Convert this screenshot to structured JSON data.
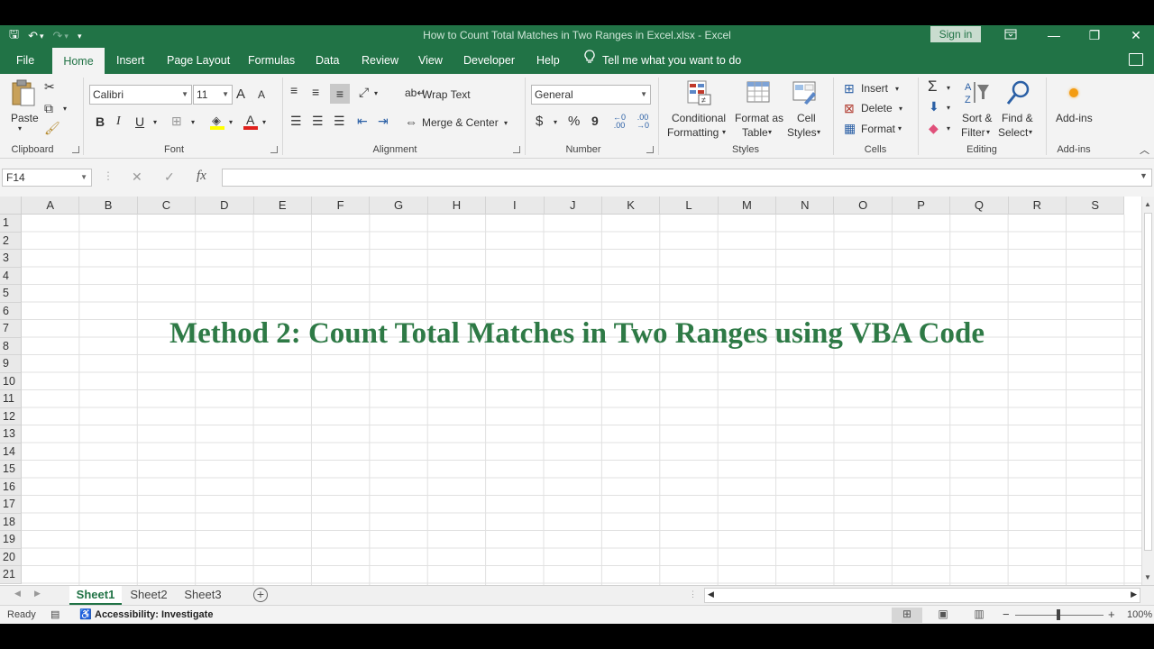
{
  "window": {
    "title": "How to Count Total Matches in Two Ranges in Excel.xlsx  -  Excel",
    "signin_label": "Sign in",
    "minimize": "—",
    "restore": "❐",
    "close": "✕"
  },
  "qat": {
    "save": "🖫",
    "undo": "↶",
    "undo_menu": "▾",
    "redo": "↷",
    "customize": "▾"
  },
  "tabs": [
    "File",
    "Home",
    "Insert",
    "Page Layout",
    "Formulas",
    "Data",
    "Review",
    "View",
    "Developer",
    "Help"
  ],
  "active_tab": "Home",
  "tell_me": "Tell me what you want to do",
  "ribbon": {
    "clipboard": {
      "paste": "Paste",
      "label": "Clipboard"
    },
    "font": {
      "name": "Calibri",
      "size": "11",
      "grow": "A",
      "shrink": "A",
      "bold": "B",
      "italic": "I",
      "underline": "U",
      "label": "Font"
    },
    "alignment": {
      "wrap_text": "Wrap Text",
      "merge_center": "Merge & Center",
      "label": "Alignment"
    },
    "number": {
      "format": "General",
      "currency": "$",
      "percent": "%",
      "comma": "9",
      "label": "Number"
    },
    "styles": {
      "conditional": [
        "Conditional",
        "Formatting"
      ],
      "format_as_table": [
        "Format as",
        "Table"
      ],
      "cell_styles": [
        "Cell",
        "Styles"
      ],
      "label": "Styles"
    },
    "cells": {
      "insert": "Insert",
      "delete": "Delete",
      "format": "Format",
      "label": "Cells"
    },
    "editing": {
      "sort_filter": [
        "Sort &",
        "Filter"
      ],
      "find_select": [
        "Find &",
        "Select"
      ],
      "label": "Editing"
    },
    "addins": {
      "button": "Add-ins",
      "label": "Add-ins"
    }
  },
  "formula_bar": {
    "name_box": "F14",
    "cancel": "✕",
    "enter": "✓",
    "fx": "fx",
    "value": ""
  },
  "columns": [
    "A",
    "B",
    "C",
    "D",
    "E",
    "F",
    "G",
    "H",
    "I",
    "J",
    "K",
    "L",
    "M",
    "N",
    "O",
    "P",
    "Q",
    "R",
    "S"
  ],
  "rows": [
    "1",
    "2",
    "3",
    "4",
    "5",
    "6",
    "7",
    "8",
    "9",
    "10",
    "11",
    "12",
    "13",
    "14",
    "15",
    "16",
    "17",
    "18",
    "19",
    "20",
    "21"
  ],
  "overlay_title": "Method 2: Count Total Matches in Two Ranges using VBA Code",
  "sheets": [
    "Sheet1",
    "Sheet2",
    "Sheet3"
  ],
  "active_sheet": "Sheet1",
  "status": {
    "ready": "Ready",
    "accessibility": "Accessibility: Investigate",
    "zoom": "100%",
    "zoom_out": "−",
    "zoom_in": "+"
  },
  "colors": {
    "excel_green": "#217346",
    "title_green": "#2e7a46"
  }
}
